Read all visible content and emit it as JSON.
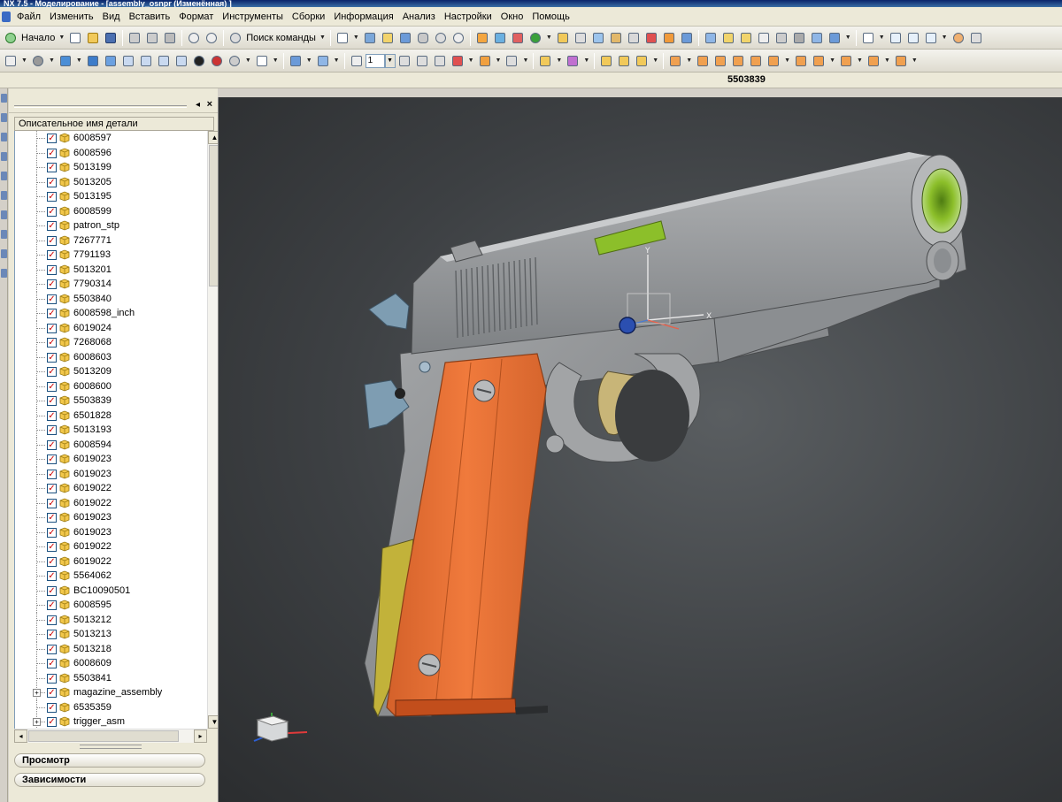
{
  "window": {
    "title": "NX 7.5 - Моделирование - [assembly_osnpr (Изменённая) ]"
  },
  "menu": [
    "Файл",
    "Изменить",
    "Вид",
    "Вставить",
    "Формат",
    "Инструменты",
    "Сборки",
    "Информация",
    "Анализ",
    "Настройки",
    "Окно",
    "Помощь"
  ],
  "toolbar": {
    "start_label": "Начало",
    "command_finder": "Поиск команды",
    "layer_value": "1"
  },
  "status": {
    "selected_part": "5503839"
  },
  "navigator": {
    "column_header": "Описательное имя детали",
    "items": [
      "6008597",
      "6008596",
      "5013199",
      "5013205",
      "5013195",
      "6008599",
      "patron_stp",
      "7267771",
      "7791193",
      "5013201",
      "7790314",
      "5503840",
      "6008598_inch",
      "6019024",
      "7268068",
      "6008603",
      "5013209",
      "6008600",
      "5503839",
      "6501828",
      "5013193",
      "6008594",
      "6019023",
      "6019023",
      "6019022",
      "6019022",
      "6019023",
      "6019023",
      "6019022",
      "6019022",
      "5564062",
      "BC10090501",
      "6008595",
      "5013212",
      "5013213",
      "5013218",
      "6008609",
      "5503841",
      "magazine_assembly",
      "6535359",
      "trigger_asm"
    ],
    "sections": {
      "view": "Просмотр",
      "dependencies": "Зависимости"
    }
  },
  "viewport": {
    "wcs_labels": {
      "x": "X",
      "y": "Y"
    },
    "colors": {
      "body": "#9a9c9e",
      "grip": "#e6763a",
      "accent": "#8cbf2a",
      "background": "#3d4043"
    }
  }
}
